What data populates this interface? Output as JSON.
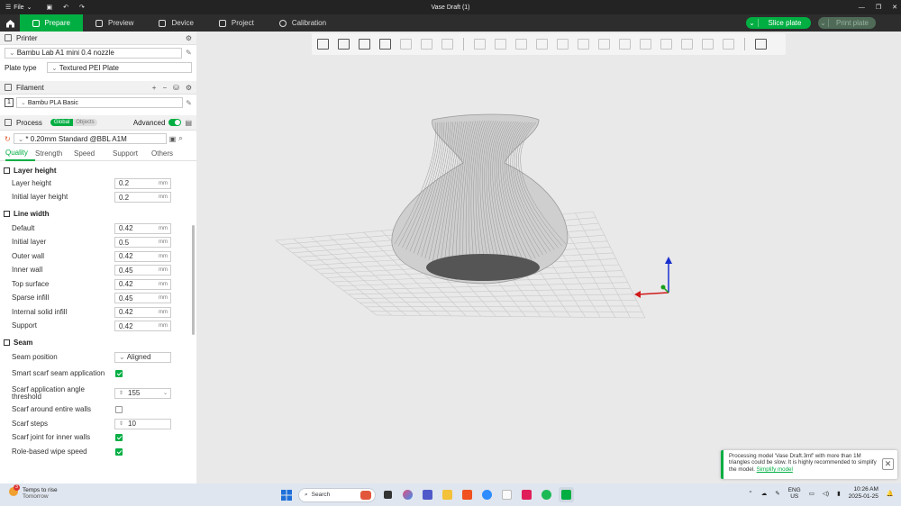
{
  "window": {
    "title": "Vase Draft (1)",
    "file_menu": "File"
  },
  "tabs": [
    "Prepare",
    "Preview",
    "Device",
    "Project",
    "Calibration"
  ],
  "actions": {
    "slice": "Slice plate",
    "print": "Print plate"
  },
  "printer": {
    "section": "Printer",
    "name": "Bambu Lab A1 mini 0.4 nozzle",
    "plate_type_label": "Plate type",
    "plate_type": "Textured PEI Plate"
  },
  "filament": {
    "section": "Filament",
    "slot": "1",
    "name": "Bambu PLA Basic"
  },
  "process": {
    "section": "Process",
    "toggle_global": "Global",
    "toggle_objects": "Objects",
    "advanced_label": "Advanced",
    "advanced_on": true,
    "preset": "* 0.20mm Standard @BBL A1M",
    "subtabs": [
      "Quality",
      "Strength",
      "Speed",
      "Support",
      "Others"
    ]
  },
  "groups": {
    "layer_height": {
      "title": "Layer height",
      "params": [
        {
          "name": "Layer height",
          "value": "0.2",
          "unit": "mm"
        },
        {
          "name": "Initial layer height",
          "value": "0.2",
          "unit": "mm"
        }
      ]
    },
    "line_width": {
      "title": "Line width",
      "params": [
        {
          "name": "Default",
          "value": "0.42",
          "unit": "mm"
        },
        {
          "name": "Initial layer",
          "value": "0.5",
          "unit": "mm"
        },
        {
          "name": "Outer wall",
          "value": "0.42",
          "unit": "mm"
        },
        {
          "name": "Inner wall",
          "value": "0.45",
          "unit": "mm"
        },
        {
          "name": "Top surface",
          "value": "0.42",
          "unit": "mm"
        },
        {
          "name": "Sparse infill",
          "value": "0.45",
          "unit": "mm"
        },
        {
          "name": "Internal solid infill",
          "value": "0.42",
          "unit": "mm"
        },
        {
          "name": "Support",
          "value": "0.42",
          "unit": "mm"
        }
      ]
    },
    "seam": {
      "title": "Seam",
      "seam_position_label": "Seam position",
      "seam_position": "Aligned",
      "smart_scarf_label": "Smart scarf seam application",
      "scarf_angle_label": "Scarf application angle threshold",
      "scarf_angle": "155",
      "scarf_entire_label": "Scarf around entire walls",
      "scarf_steps_label": "Scarf steps",
      "scarf_steps": "10",
      "scarf_inner_label": "Scarf joint for inner walls",
      "wipe_speed_label": "Role-based wipe speed"
    }
  },
  "toast": {
    "message": "Processing model 'Vase Draft.3mf' with more than 1M triangles could be slow. It is highly recommended to simplify the model.",
    "link": "Simplify model"
  },
  "taskbar": {
    "weather_title": "Temps to rise",
    "weather_sub": "Tomorrow",
    "weather_badge": "3",
    "search_placeholder": "Search",
    "lang": "ENG",
    "region": "US",
    "time": "10:26 AM",
    "date": "2025-01-25"
  },
  "colors": {
    "accent": "#00ae42",
    "titlebar": "#232323",
    "tabbar": "#2d2d2d"
  }
}
